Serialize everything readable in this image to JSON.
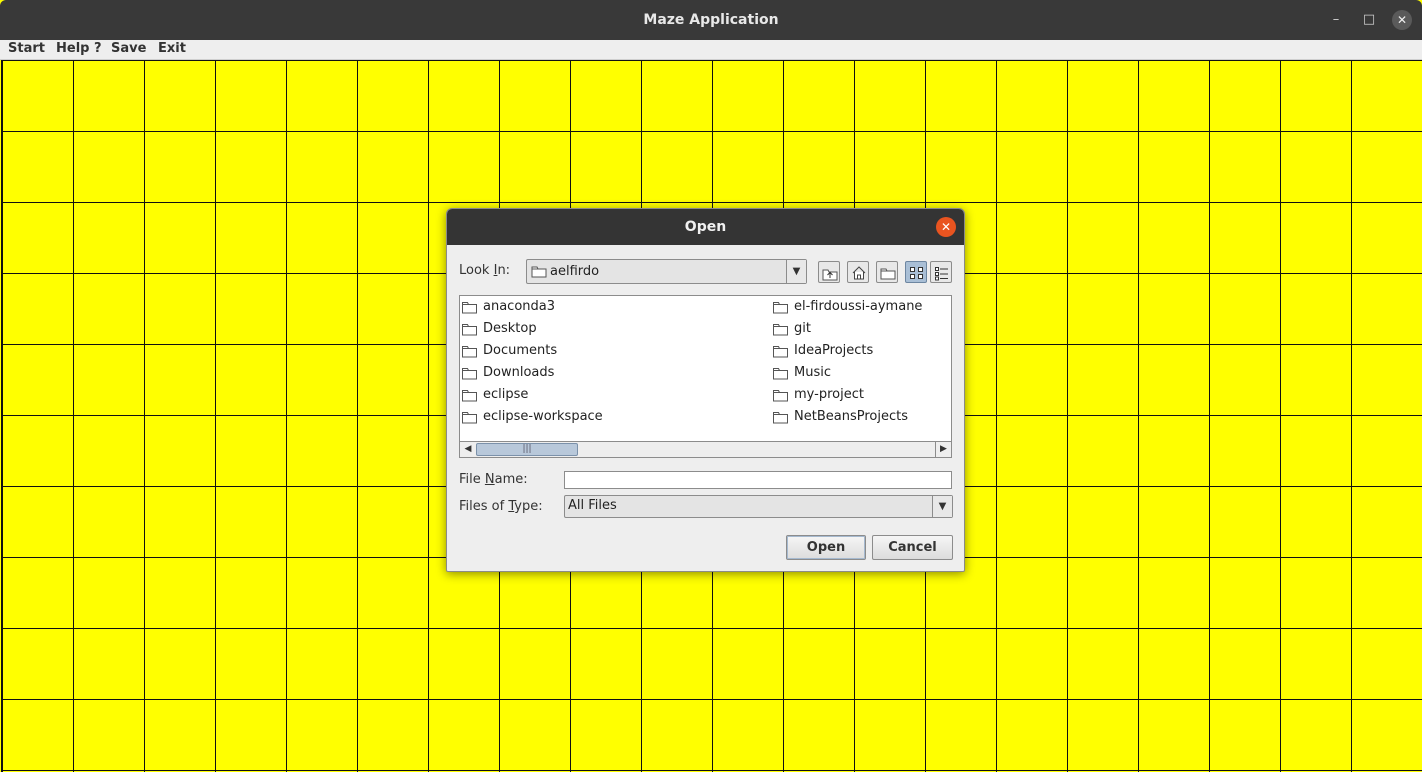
{
  "window": {
    "title": "Maze Application",
    "controls": {
      "minimize": "–",
      "maximize": "□",
      "close": "✕"
    }
  },
  "menubar": {
    "items": [
      "Start",
      "Help ?",
      "Save",
      "Exit"
    ]
  },
  "maze": {
    "cell_color": "#ffff00",
    "line_color": "#111111"
  },
  "dialog": {
    "title": "Open",
    "look_in": {
      "label_prefix": "Look ",
      "label_mnemonic": "I",
      "label_suffix": "n:",
      "value": "aelfirdo"
    },
    "toolbar_icons": [
      "up-one-level-icon",
      "home-icon",
      "new-folder-icon",
      "list-view-icon",
      "details-view-icon"
    ],
    "files": {
      "left": [
        "anaconda3",
        "Desktop",
        "Documents",
        "Downloads",
        "eclipse",
        "eclipse-workspace"
      ],
      "right": [
        "el-firdoussi-aymane",
        "git",
        "IdeaProjects",
        "Music",
        "my-project",
        "NetBeansProjects"
      ]
    },
    "scroll_thumb_grip": "|||",
    "file_name": {
      "label_prefix": "File ",
      "label_mnemonic": "N",
      "label_suffix": "ame:",
      "value": ""
    },
    "files_of_type": {
      "label_prefix": "Files of ",
      "label_mnemonic": "T",
      "label_suffix": "ype:",
      "value": "All Files"
    },
    "buttons": {
      "open": "Open",
      "cancel": "Cancel"
    },
    "close_glyph": "✕"
  }
}
